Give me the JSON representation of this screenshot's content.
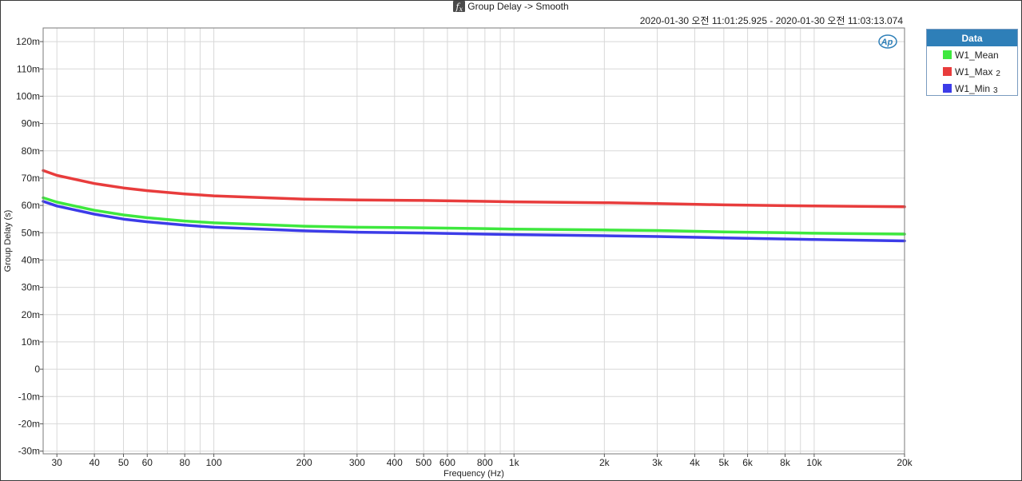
{
  "header": {
    "title": "Group Delay -> Smooth",
    "fx_icon": "function-icon",
    "timestamp": "2020-01-30 오전 11:01:25.925 - 2020-01-30 오전 11:03:13.074"
  },
  "brand_logo": "Ap",
  "legend": {
    "title": "Data",
    "items": [
      {
        "label": "W1_Mean",
        "suffix": "",
        "color": "#3ee83e"
      },
      {
        "label": "W1_Max",
        "suffix": "2",
        "color": "#e83c3c"
      },
      {
        "label": "W1_Min",
        "suffix": "3",
        "color": "#3c3ce8"
      }
    ]
  },
  "chart_data": {
    "type": "line",
    "xlabel": "Frequency (Hz)",
    "ylabel": "Group Delay (s)",
    "xscale": "log",
    "xlim": [
      27,
      20000
    ],
    "ylim": [
      -0.031,
      0.125
    ],
    "x_tick_labels": [
      {
        "value": 30,
        "label": "30"
      },
      {
        "value": 40,
        "label": "40"
      },
      {
        "value": 50,
        "label": "50"
      },
      {
        "value": 60,
        "label": "60"
      },
      {
        "value": 80,
        "label": "80"
      },
      {
        "value": 100,
        "label": "100"
      },
      {
        "value": 200,
        "label": "200"
      },
      {
        "value": 300,
        "label": "300"
      },
      {
        "value": 400,
        "label": "400"
      },
      {
        "value": 500,
        "label": "500"
      },
      {
        "value": 600,
        "label": "600"
      },
      {
        "value": 800,
        "label": "800"
      },
      {
        "value": 1000,
        "label": "1k"
      },
      {
        "value": 2000,
        "label": "2k"
      },
      {
        "value": 3000,
        "label": "3k"
      },
      {
        "value": 4000,
        "label": "4k"
      },
      {
        "value": 5000,
        "label": "5k"
      },
      {
        "value": 6000,
        "label": "6k"
      },
      {
        "value": 8000,
        "label": "8k"
      },
      {
        "value": 10000,
        "label": "10k"
      },
      {
        "value": 20000,
        "label": "20k"
      }
    ],
    "y_tick_labels": [
      {
        "value": 0.12,
        "label": "120m"
      },
      {
        "value": 0.11,
        "label": "110m"
      },
      {
        "value": 0.1,
        "label": "100m"
      },
      {
        "value": 0.09,
        "label": "90m"
      },
      {
        "value": 0.08,
        "label": "80m"
      },
      {
        "value": 0.07,
        "label": "70m"
      },
      {
        "value": 0.06,
        "label": "60m"
      },
      {
        "value": 0.05,
        "label": "50m"
      },
      {
        "value": 0.04,
        "label": "40m"
      },
      {
        "value": 0.03,
        "label": "30m"
      },
      {
        "value": 0.02,
        "label": "20m"
      },
      {
        "value": 0.01,
        "label": "10m"
      },
      {
        "value": 0,
        "label": "0"
      },
      {
        "value": -0.01,
        "label": "-10m"
      },
      {
        "value": -0.02,
        "label": "-20m"
      },
      {
        "value": -0.03,
        "label": "-30m"
      }
    ],
    "grid": true,
    "legend_position": "right",
    "series": [
      {
        "name": "W1_Mean",
        "color": "#3ee83e",
        "x": [
          27,
          30,
          40,
          50,
          60,
          80,
          100,
          200,
          300,
          500,
          800,
          1000,
          2000,
          3000,
          5000,
          8000,
          10000,
          20000
        ],
        "y": [
          0.0628,
          0.0612,
          0.0582,
          0.0565,
          0.0555,
          0.0543,
          0.0536,
          0.0524,
          0.052,
          0.0518,
          0.0515,
          0.0513,
          0.051,
          0.0508,
          0.0503,
          0.05,
          0.0498,
          0.0495
        ]
      },
      {
        "name": "W1_Max",
        "color": "#e83c3c",
        "x": [
          27,
          30,
          40,
          50,
          60,
          80,
          100,
          200,
          300,
          500,
          800,
          1000,
          2000,
          3000,
          5000,
          8000,
          10000,
          20000
        ],
        "y": [
          0.0728,
          0.071,
          0.068,
          0.0664,
          0.0654,
          0.0642,
          0.0635,
          0.0623,
          0.062,
          0.0618,
          0.0615,
          0.0613,
          0.061,
          0.0607,
          0.0602,
          0.0599,
          0.0598,
          0.0595
        ]
      },
      {
        "name": "W1_Min",
        "color": "#3c3ce8",
        "x": [
          27,
          30,
          40,
          50,
          60,
          80,
          100,
          200,
          300,
          500,
          800,
          1000,
          2000,
          3000,
          5000,
          8000,
          10000,
          20000
        ],
        "y": [
          0.0615,
          0.0598,
          0.0568,
          0.055,
          0.054,
          0.0528,
          0.052,
          0.0507,
          0.0502,
          0.0499,
          0.0495,
          0.0493,
          0.0489,
          0.0486,
          0.0481,
          0.0477,
          0.0475,
          0.047
        ]
      }
    ]
  }
}
